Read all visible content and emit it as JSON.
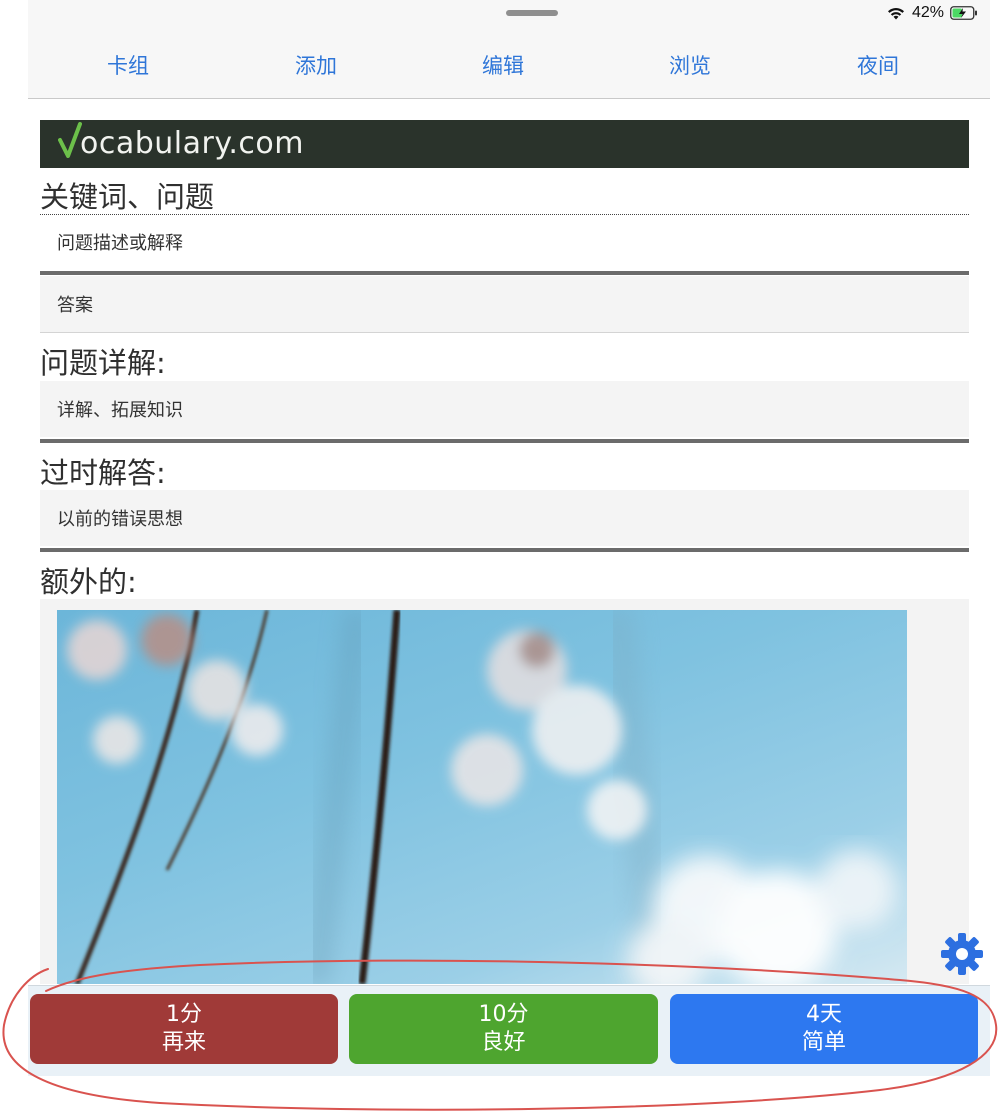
{
  "status": {
    "battery_percent": "42%",
    "wifi": "wifi-icon",
    "battery": "battery-charging-icon"
  },
  "nav": {
    "items": [
      {
        "label": "卡组"
      },
      {
        "label": "添加"
      },
      {
        "label": "编辑"
      },
      {
        "label": "浏览"
      },
      {
        "label": "夜间"
      }
    ]
  },
  "logo": {
    "text": "ocabulary.com"
  },
  "card": {
    "keyword_heading": "关键词、问题",
    "question_field": "问题描述或解释",
    "answer_field": "答案",
    "detail_heading": "问题详解:",
    "detail_field": "详解、拓展知识",
    "outdated_heading": "过时解答:",
    "outdated_field": "以前的错误思想",
    "extra_heading": "额外的:"
  },
  "answers": {
    "again": {
      "interval": "1分",
      "label": "再来",
      "color": "#a03a38"
    },
    "good": {
      "interval": "10分",
      "label": "良好",
      "color": "#4ea52f"
    },
    "easy": {
      "interval": "4天",
      "label": "简单",
      "color": "#2d78f0"
    }
  },
  "colors": {
    "nav_link": "#2f76d8",
    "logo_bg": "#2a332b",
    "logo_check": "#6cc04a",
    "annotation": "#d9534f",
    "gear": "#2d6fe0"
  },
  "icons": {
    "settings": "gear-icon"
  }
}
